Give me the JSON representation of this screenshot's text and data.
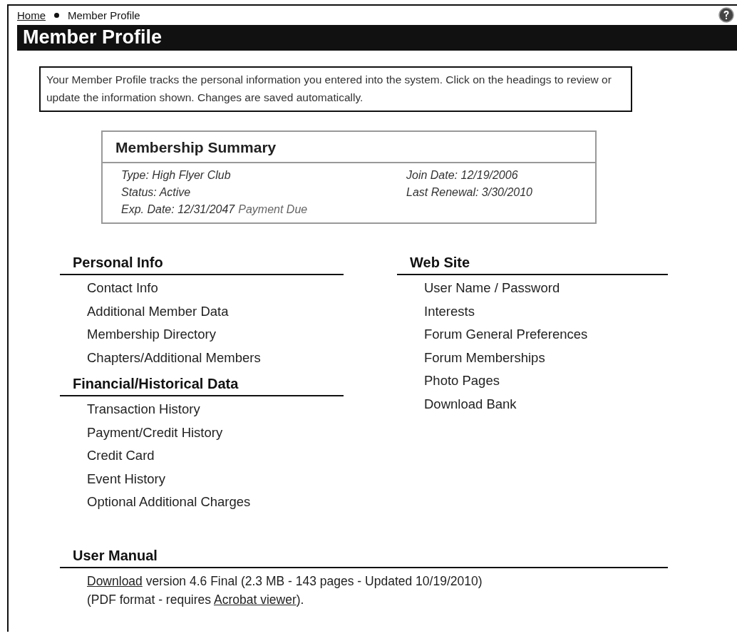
{
  "breadcrumb": [
    {
      "label": "Home",
      "kind": "link"
    },
    {
      "label": "Member Profile",
      "kind": "current"
    }
  ],
  "page_title": "Member Profile",
  "intro": "Your Member Profile tracks the personal information you entered into the system. Click on the headings to review or update the information shown. Changes are saved automatically.",
  "summary": {
    "title": "Membership Summary",
    "left": [
      {
        "text": "Type: High Flyer Club"
      },
      {
        "text": "Status: Active"
      },
      {
        "text": "Exp. Date: 12/31/2047",
        "note": "Payment Due"
      }
    ],
    "right": [
      {
        "text": "Join Date: 12/19/2006"
      },
      {
        "text": "Last Renewal: 3/30/2010"
      }
    ]
  },
  "columns": [
    [
      {
        "heading": "Personal Info",
        "items": [
          "Contact Info",
          "Additional Member Data",
          "Membership Directory",
          "Chapters/Additional Members"
        ]
      },
      {
        "heading": "Financial/Historical Data",
        "items": [
          "Transaction History",
          "Payment/Credit History",
          "Credit Card",
          "Event History",
          "Optional Additional Charges"
        ]
      }
    ],
    [
      {
        "heading": "Web Site",
        "items": [
          "User Name / Password",
          "Interests",
          "Forum General Preferences",
          "Forum Memberships",
          "Photo Pages",
          "Download Bank"
        ]
      }
    ]
  ],
  "manual": {
    "heading": "User Manual",
    "lines": [
      [
        {
          "kind": "link",
          "text": "Download"
        },
        {
          "kind": "text",
          "text": " version 4.6 Final (2.3 MB - 143 pages - Updated 10/19/2010)"
        }
      ],
      [
        {
          "kind": "text",
          "text": "(PDF format - requires "
        },
        {
          "kind": "link",
          "text": "Acrobat viewer"
        },
        {
          "kind": "text",
          "text": ")."
        }
      ]
    ]
  }
}
